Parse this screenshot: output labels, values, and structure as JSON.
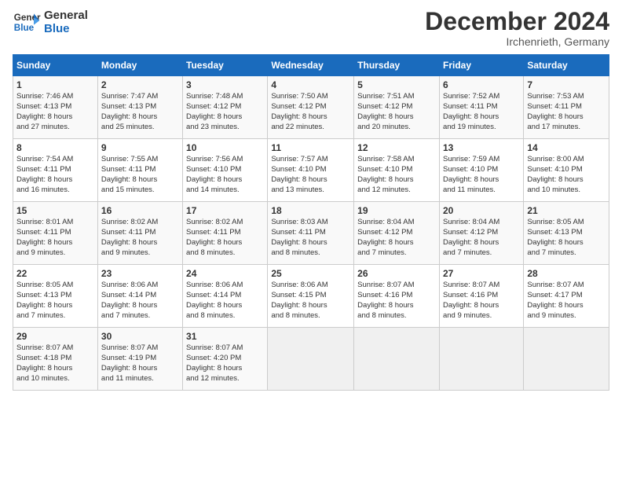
{
  "logo": {
    "line1": "General",
    "line2": "Blue"
  },
  "title": "December 2024",
  "subtitle": "Irchenrieth, Germany",
  "weekdays": [
    "Sunday",
    "Monday",
    "Tuesday",
    "Wednesday",
    "Thursday",
    "Friday",
    "Saturday"
  ],
  "weeks": [
    [
      {
        "day": "1",
        "info": "Sunrise: 7:46 AM\nSunset: 4:13 PM\nDaylight: 8 hours\nand 27 minutes."
      },
      {
        "day": "2",
        "info": "Sunrise: 7:47 AM\nSunset: 4:13 PM\nDaylight: 8 hours\nand 25 minutes."
      },
      {
        "day": "3",
        "info": "Sunrise: 7:48 AM\nSunset: 4:12 PM\nDaylight: 8 hours\nand 23 minutes."
      },
      {
        "day": "4",
        "info": "Sunrise: 7:50 AM\nSunset: 4:12 PM\nDaylight: 8 hours\nand 22 minutes."
      },
      {
        "day": "5",
        "info": "Sunrise: 7:51 AM\nSunset: 4:12 PM\nDaylight: 8 hours\nand 20 minutes."
      },
      {
        "day": "6",
        "info": "Sunrise: 7:52 AM\nSunset: 4:11 PM\nDaylight: 8 hours\nand 19 minutes."
      },
      {
        "day": "7",
        "info": "Sunrise: 7:53 AM\nSunset: 4:11 PM\nDaylight: 8 hours\nand 17 minutes."
      }
    ],
    [
      {
        "day": "8",
        "info": "Sunrise: 7:54 AM\nSunset: 4:11 PM\nDaylight: 8 hours\nand 16 minutes."
      },
      {
        "day": "9",
        "info": "Sunrise: 7:55 AM\nSunset: 4:11 PM\nDaylight: 8 hours\nand 15 minutes."
      },
      {
        "day": "10",
        "info": "Sunrise: 7:56 AM\nSunset: 4:10 PM\nDaylight: 8 hours\nand 14 minutes."
      },
      {
        "day": "11",
        "info": "Sunrise: 7:57 AM\nSunset: 4:10 PM\nDaylight: 8 hours\nand 13 minutes."
      },
      {
        "day": "12",
        "info": "Sunrise: 7:58 AM\nSunset: 4:10 PM\nDaylight: 8 hours\nand 12 minutes."
      },
      {
        "day": "13",
        "info": "Sunrise: 7:59 AM\nSunset: 4:10 PM\nDaylight: 8 hours\nand 11 minutes."
      },
      {
        "day": "14",
        "info": "Sunrise: 8:00 AM\nSunset: 4:10 PM\nDaylight: 8 hours\nand 10 minutes."
      }
    ],
    [
      {
        "day": "15",
        "info": "Sunrise: 8:01 AM\nSunset: 4:11 PM\nDaylight: 8 hours\nand 9 minutes."
      },
      {
        "day": "16",
        "info": "Sunrise: 8:02 AM\nSunset: 4:11 PM\nDaylight: 8 hours\nand 9 minutes."
      },
      {
        "day": "17",
        "info": "Sunrise: 8:02 AM\nSunset: 4:11 PM\nDaylight: 8 hours\nand 8 minutes."
      },
      {
        "day": "18",
        "info": "Sunrise: 8:03 AM\nSunset: 4:11 PM\nDaylight: 8 hours\nand 8 minutes."
      },
      {
        "day": "19",
        "info": "Sunrise: 8:04 AM\nSunset: 4:12 PM\nDaylight: 8 hours\nand 7 minutes."
      },
      {
        "day": "20",
        "info": "Sunrise: 8:04 AM\nSunset: 4:12 PM\nDaylight: 8 hours\nand 7 minutes."
      },
      {
        "day": "21",
        "info": "Sunrise: 8:05 AM\nSunset: 4:13 PM\nDaylight: 8 hours\nand 7 minutes."
      }
    ],
    [
      {
        "day": "22",
        "info": "Sunrise: 8:05 AM\nSunset: 4:13 PM\nDaylight: 8 hours\nand 7 minutes."
      },
      {
        "day": "23",
        "info": "Sunrise: 8:06 AM\nSunset: 4:14 PM\nDaylight: 8 hours\nand 7 minutes."
      },
      {
        "day": "24",
        "info": "Sunrise: 8:06 AM\nSunset: 4:14 PM\nDaylight: 8 hours\nand 8 minutes."
      },
      {
        "day": "25",
        "info": "Sunrise: 8:06 AM\nSunset: 4:15 PM\nDaylight: 8 hours\nand 8 minutes."
      },
      {
        "day": "26",
        "info": "Sunrise: 8:07 AM\nSunset: 4:16 PM\nDaylight: 8 hours\nand 8 minutes."
      },
      {
        "day": "27",
        "info": "Sunrise: 8:07 AM\nSunset: 4:16 PM\nDaylight: 8 hours\nand 9 minutes."
      },
      {
        "day": "28",
        "info": "Sunrise: 8:07 AM\nSunset: 4:17 PM\nDaylight: 8 hours\nand 9 minutes."
      }
    ],
    [
      {
        "day": "29",
        "info": "Sunrise: 8:07 AM\nSunset: 4:18 PM\nDaylight: 8 hours\nand 10 minutes."
      },
      {
        "day": "30",
        "info": "Sunrise: 8:07 AM\nSunset: 4:19 PM\nDaylight: 8 hours\nand 11 minutes."
      },
      {
        "day": "31",
        "info": "Sunrise: 8:07 AM\nSunset: 4:20 PM\nDaylight: 8 hours\nand 12 minutes."
      },
      {
        "day": "",
        "info": ""
      },
      {
        "day": "",
        "info": ""
      },
      {
        "day": "",
        "info": ""
      },
      {
        "day": "",
        "info": ""
      }
    ]
  ]
}
